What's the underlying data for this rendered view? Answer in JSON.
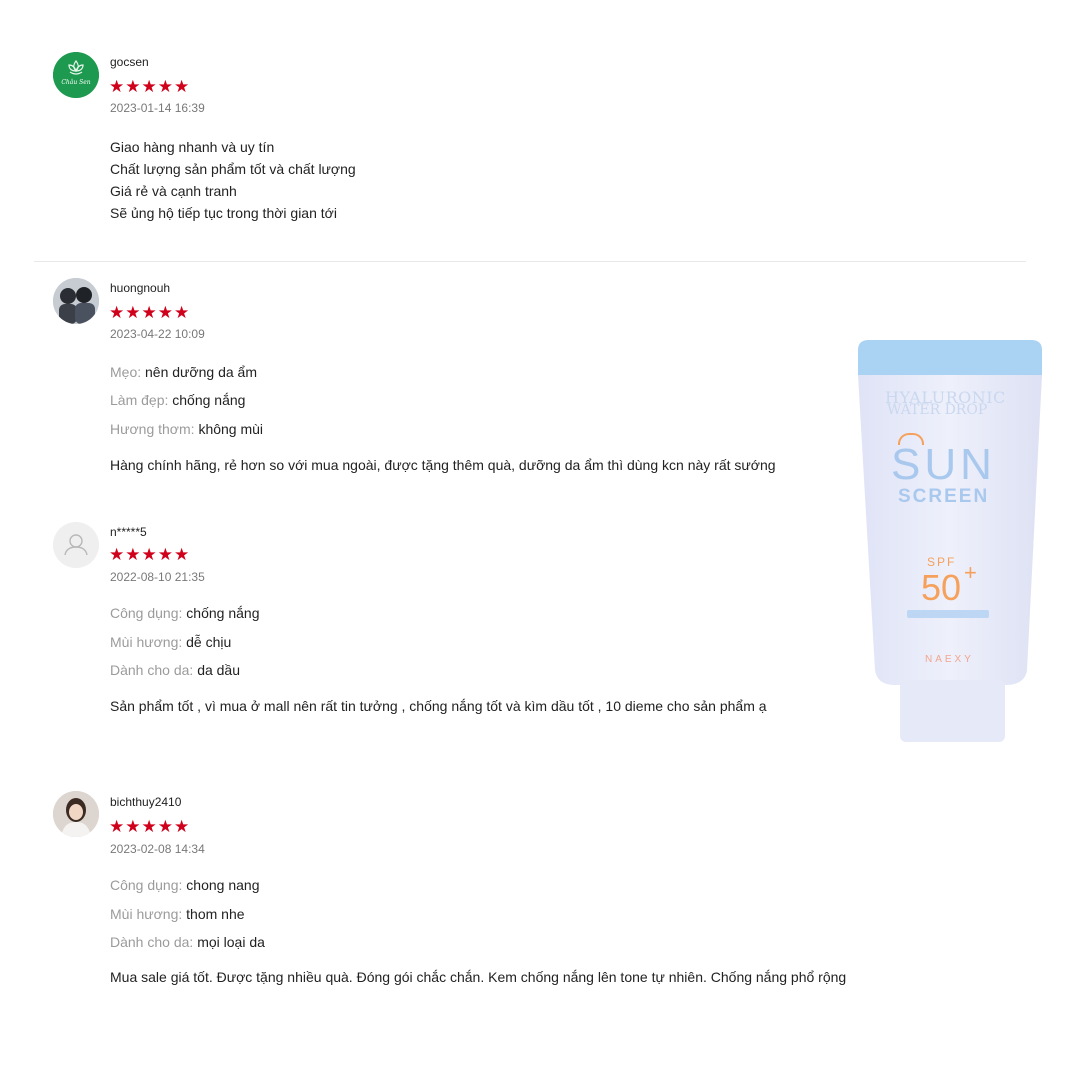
{
  "reviews": [
    {
      "username": "gocsen",
      "stars": "★★★★★",
      "date": "2023-01-14 16:39",
      "avatar_text": "Châu Sen",
      "lines": [
        "Giao hàng nhanh và uy tín",
        "Chất lượng sản phẩm tốt và chất lượng",
        "Giá rẻ và cạnh tranh",
        "Sẽ ủng hộ tiếp tục trong thời gian tới"
      ]
    },
    {
      "username": "huongnouh",
      "stars": "★★★★★",
      "date": "2023-04-22 10:09",
      "attributes": [
        {
          "label": "Mẹo:",
          "value": "nên dưỡng da ẩm"
        },
        {
          "label": "Làm đẹp:",
          "value": "chống nắng"
        },
        {
          "label": "Hương thơm:",
          "value": "không mùi"
        }
      ],
      "comment": "Hàng chính hãng, rẻ hơn so với mua ngoài, được tặng thêm quà, dưỡng da ẩm thì dùng kcn này rất sướng"
    },
    {
      "username": "n*****5",
      "stars": "★★★★★",
      "date": "2022-08-10 21:35",
      "attributes": [
        {
          "label": "Công dụng:",
          "value": "chống nắng"
        },
        {
          "label": "Mùi hương:",
          "value": "dễ chịu"
        },
        {
          "label": "Dành cho da:",
          "value": "da dầu"
        }
      ],
      "comment": "Sản phẩm tốt , vì mua ở mall nên rất tin tưởng  , chống nắng tốt và kìm dầu tốt , 10 dieme cho sản phẩm ạ"
    },
    {
      "username": "bichthuy2410",
      "stars": "★★★★★",
      "date": "2023-02-08 14:34",
      "attributes": [
        {
          "label": "Công dụng:",
          "value": "chong nang"
        },
        {
          "label": "Mùi hương:",
          "value": "thom nhe"
        },
        {
          "label": "Dành cho da:",
          "value": "mọi loại da"
        }
      ],
      "comment": "Mua sale giá tốt. Được tặng nhiều quà. Đóng gói chắc chắn. Kem chống nắng lên tone tự nhiên. Chống nắng phổ rộng"
    }
  ],
  "product": {
    "line1": "HYALURONIC",
    "line2": "WATER DROP",
    "sun": "SUN",
    "screen": "SCREEN",
    "spf_prefix": "SPF",
    "spf_value": "50",
    "spf_plus": "+",
    "brand": "NAEXY"
  },
  "colors": {
    "star": "#d0011b",
    "label": "#9b9b9b",
    "tube_cap": "#a9d2f3",
    "tube_body": "#e9ecfa",
    "spf": "#f6a15b"
  }
}
